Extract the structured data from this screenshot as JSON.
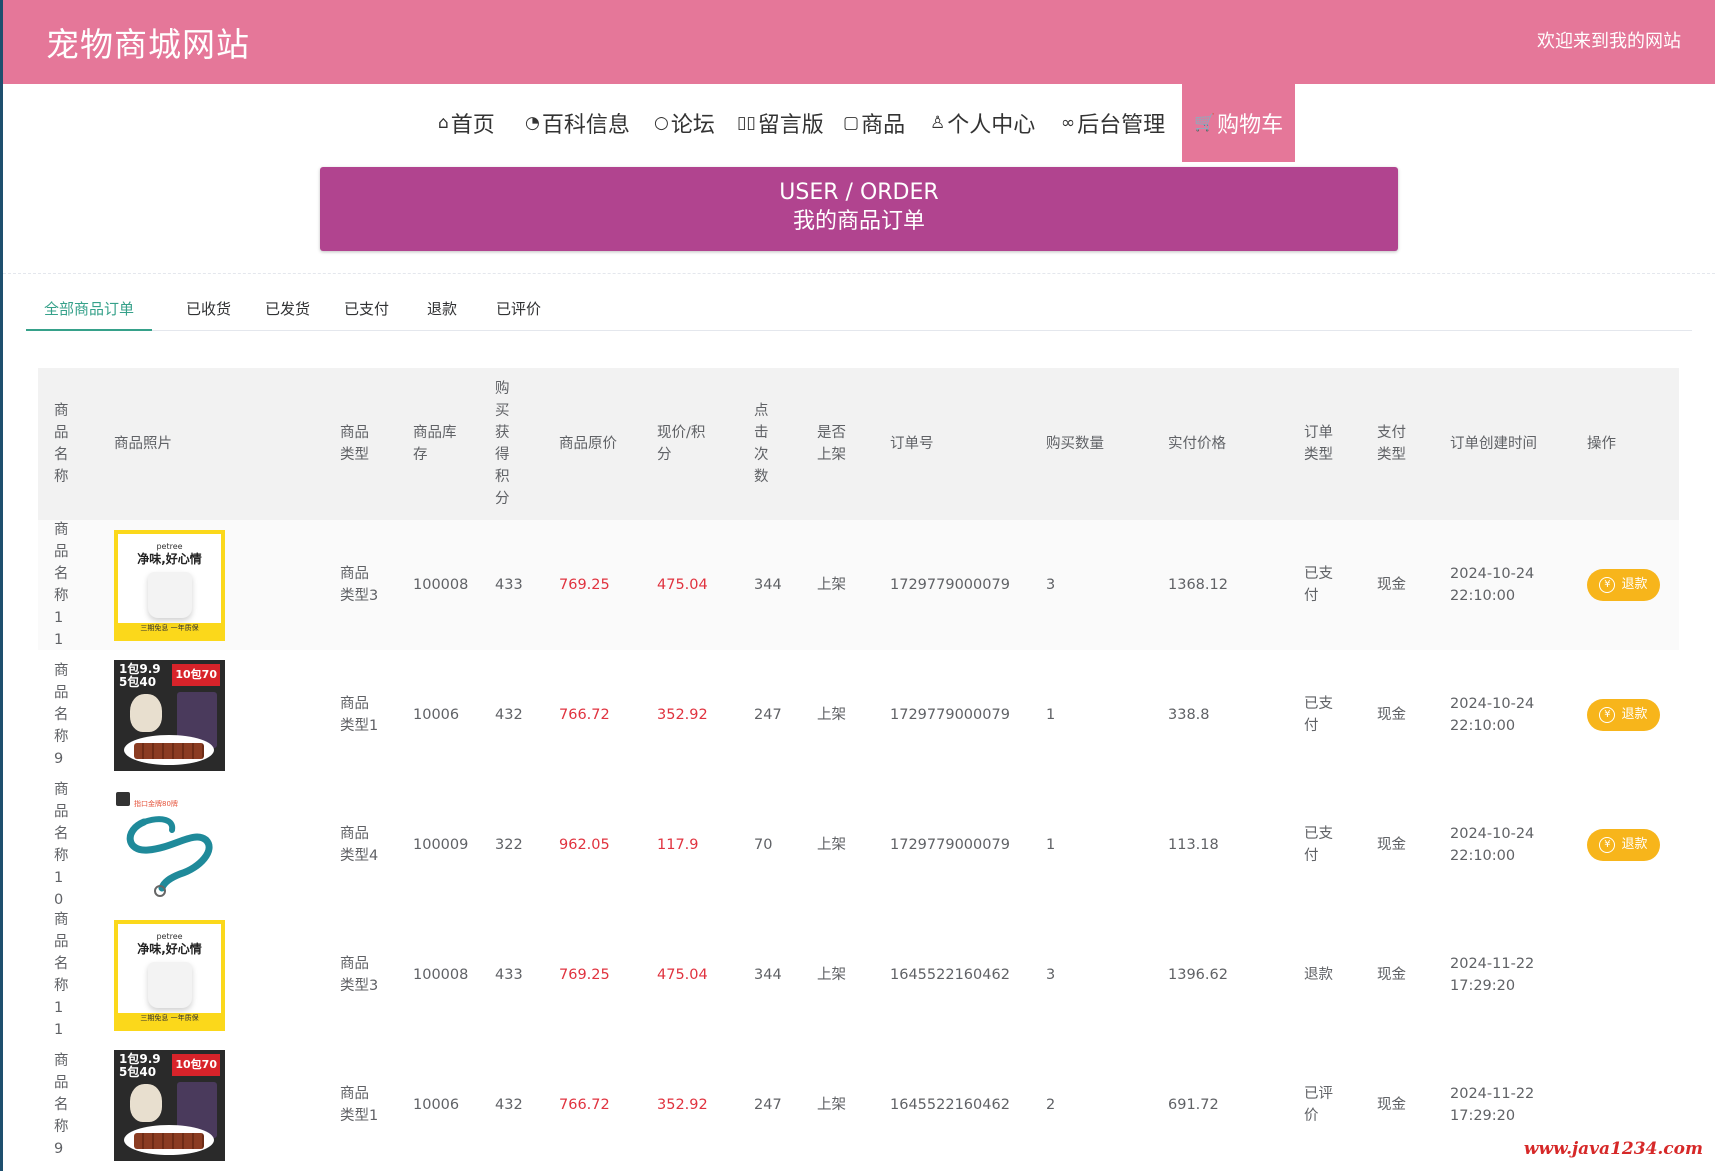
{
  "header": {
    "site_title": "宠物商城网站",
    "welcome": "欢迎来到我的网站"
  },
  "nav": {
    "items": [
      {
        "icon": "home-icon",
        "label": "首页"
      },
      {
        "icon": "dashboard-icon",
        "label": "百科信息"
      },
      {
        "icon": "chat-icon",
        "label": "论坛"
      },
      {
        "icon": "message-icon",
        "label": "留言版"
      },
      {
        "icon": "document-icon",
        "label": "商品"
      },
      {
        "icon": "user-icon",
        "label": "个人中心"
      },
      {
        "icon": "link-icon",
        "label": "后台管理"
      },
      {
        "icon": "cart-icon",
        "label": "购物车"
      }
    ],
    "active": "购物车"
  },
  "banner": {
    "en": "USER / ORDER",
    "cn": "我的商品订单"
  },
  "tabs": {
    "items": [
      "全部商品订单",
      "已收货",
      "已发货",
      "已支付",
      "退款",
      "已评价"
    ],
    "active": "全部商品订单"
  },
  "table": {
    "headers": {
      "name": "商品名称",
      "photo": "商品照片",
      "type": "商品类型",
      "stock": "商品库存",
      "points": "购买获得积分",
      "orig_price": "商品原价",
      "cur_price": "现价/积分",
      "clicks": "点击次数",
      "shelf": "是否上架",
      "order_no": "订单号",
      "qty": "购买数量",
      "paid": "实付价格",
      "order_type": "订单类型",
      "pay_type": "支付类型",
      "created": "订单创建时间",
      "action": "操作"
    },
    "rows": [
      {
        "name": "商品名称11",
        "photo": "roll",
        "type": "商品类型3",
        "stock": "100008",
        "points": "433",
        "orig_price": "769.25",
        "cur_price": "475.04",
        "clicks": "344",
        "shelf": "上架",
        "order_no": "1729779000079",
        "qty": "3",
        "paid": "1368.12",
        "order_type": "已支付",
        "pay_type": "现金",
        "date": "2024-10-24",
        "time": "22:10:00",
        "action": "退款"
      },
      {
        "name": "商品名称9",
        "photo": "snack",
        "type": "商品类型1",
        "stock": "10006",
        "points": "432",
        "orig_price": "766.72",
        "cur_price": "352.92",
        "clicks": "247",
        "shelf": "上架",
        "order_no": "1729779000079",
        "qty": "1",
        "paid": "338.8",
        "order_type": "已支付",
        "pay_type": "现金",
        "date": "2024-10-24",
        "time": "22:10:00",
        "action": "退款"
      },
      {
        "name": "商品名称10",
        "photo": "leash",
        "type": "商品类型4",
        "stock": "100009",
        "points": "322",
        "orig_price": "962.05",
        "cur_price": "117.9",
        "clicks": "70",
        "shelf": "上架",
        "order_no": "1729779000079",
        "qty": "1",
        "paid": "113.18",
        "order_type": "已支付",
        "pay_type": "现金",
        "date": "2024-10-24",
        "time": "22:10:00",
        "action": "退款"
      },
      {
        "name": "商品名称11",
        "photo": "roll",
        "type": "商品类型3",
        "stock": "100008",
        "points": "433",
        "orig_price": "769.25",
        "cur_price": "475.04",
        "clicks": "344",
        "shelf": "上架",
        "order_no": "1645522160462",
        "qty": "3",
        "paid": "1396.62",
        "order_type": "退款",
        "pay_type": "现金",
        "date": "2024-11-22",
        "time": "17:29:20",
        "action": ""
      },
      {
        "name": "商品名称9",
        "photo": "snack",
        "type": "商品类型1",
        "stock": "10006",
        "points": "432",
        "orig_price": "766.72",
        "cur_price": "352.92",
        "clicks": "247",
        "shelf": "上架",
        "order_no": "1645522160462",
        "qty": "2",
        "paid": "691.72",
        "order_type": "已评价",
        "pay_type": "现金",
        "date": "2024-11-22",
        "time": "17:29:20",
        "action": ""
      }
    ]
  },
  "photos": {
    "roll": {
      "brand": "petree",
      "slogan": "净味,好心情",
      "foot": "三期免息    一年质保"
    },
    "snack": {
      "t1": "1包9.9",
      "t1b": "5包40",
      "t2": "10包70"
    },
    "leash": {
      "tag": "指口金牌80牌"
    }
  },
  "colors": {
    "header": "#e57799",
    "banner": "#b1448f",
    "tab_active": "#36a18a",
    "price": "#e0333f",
    "refund_button": "#f7b51b"
  },
  "watermark": "www.java1234.com"
}
